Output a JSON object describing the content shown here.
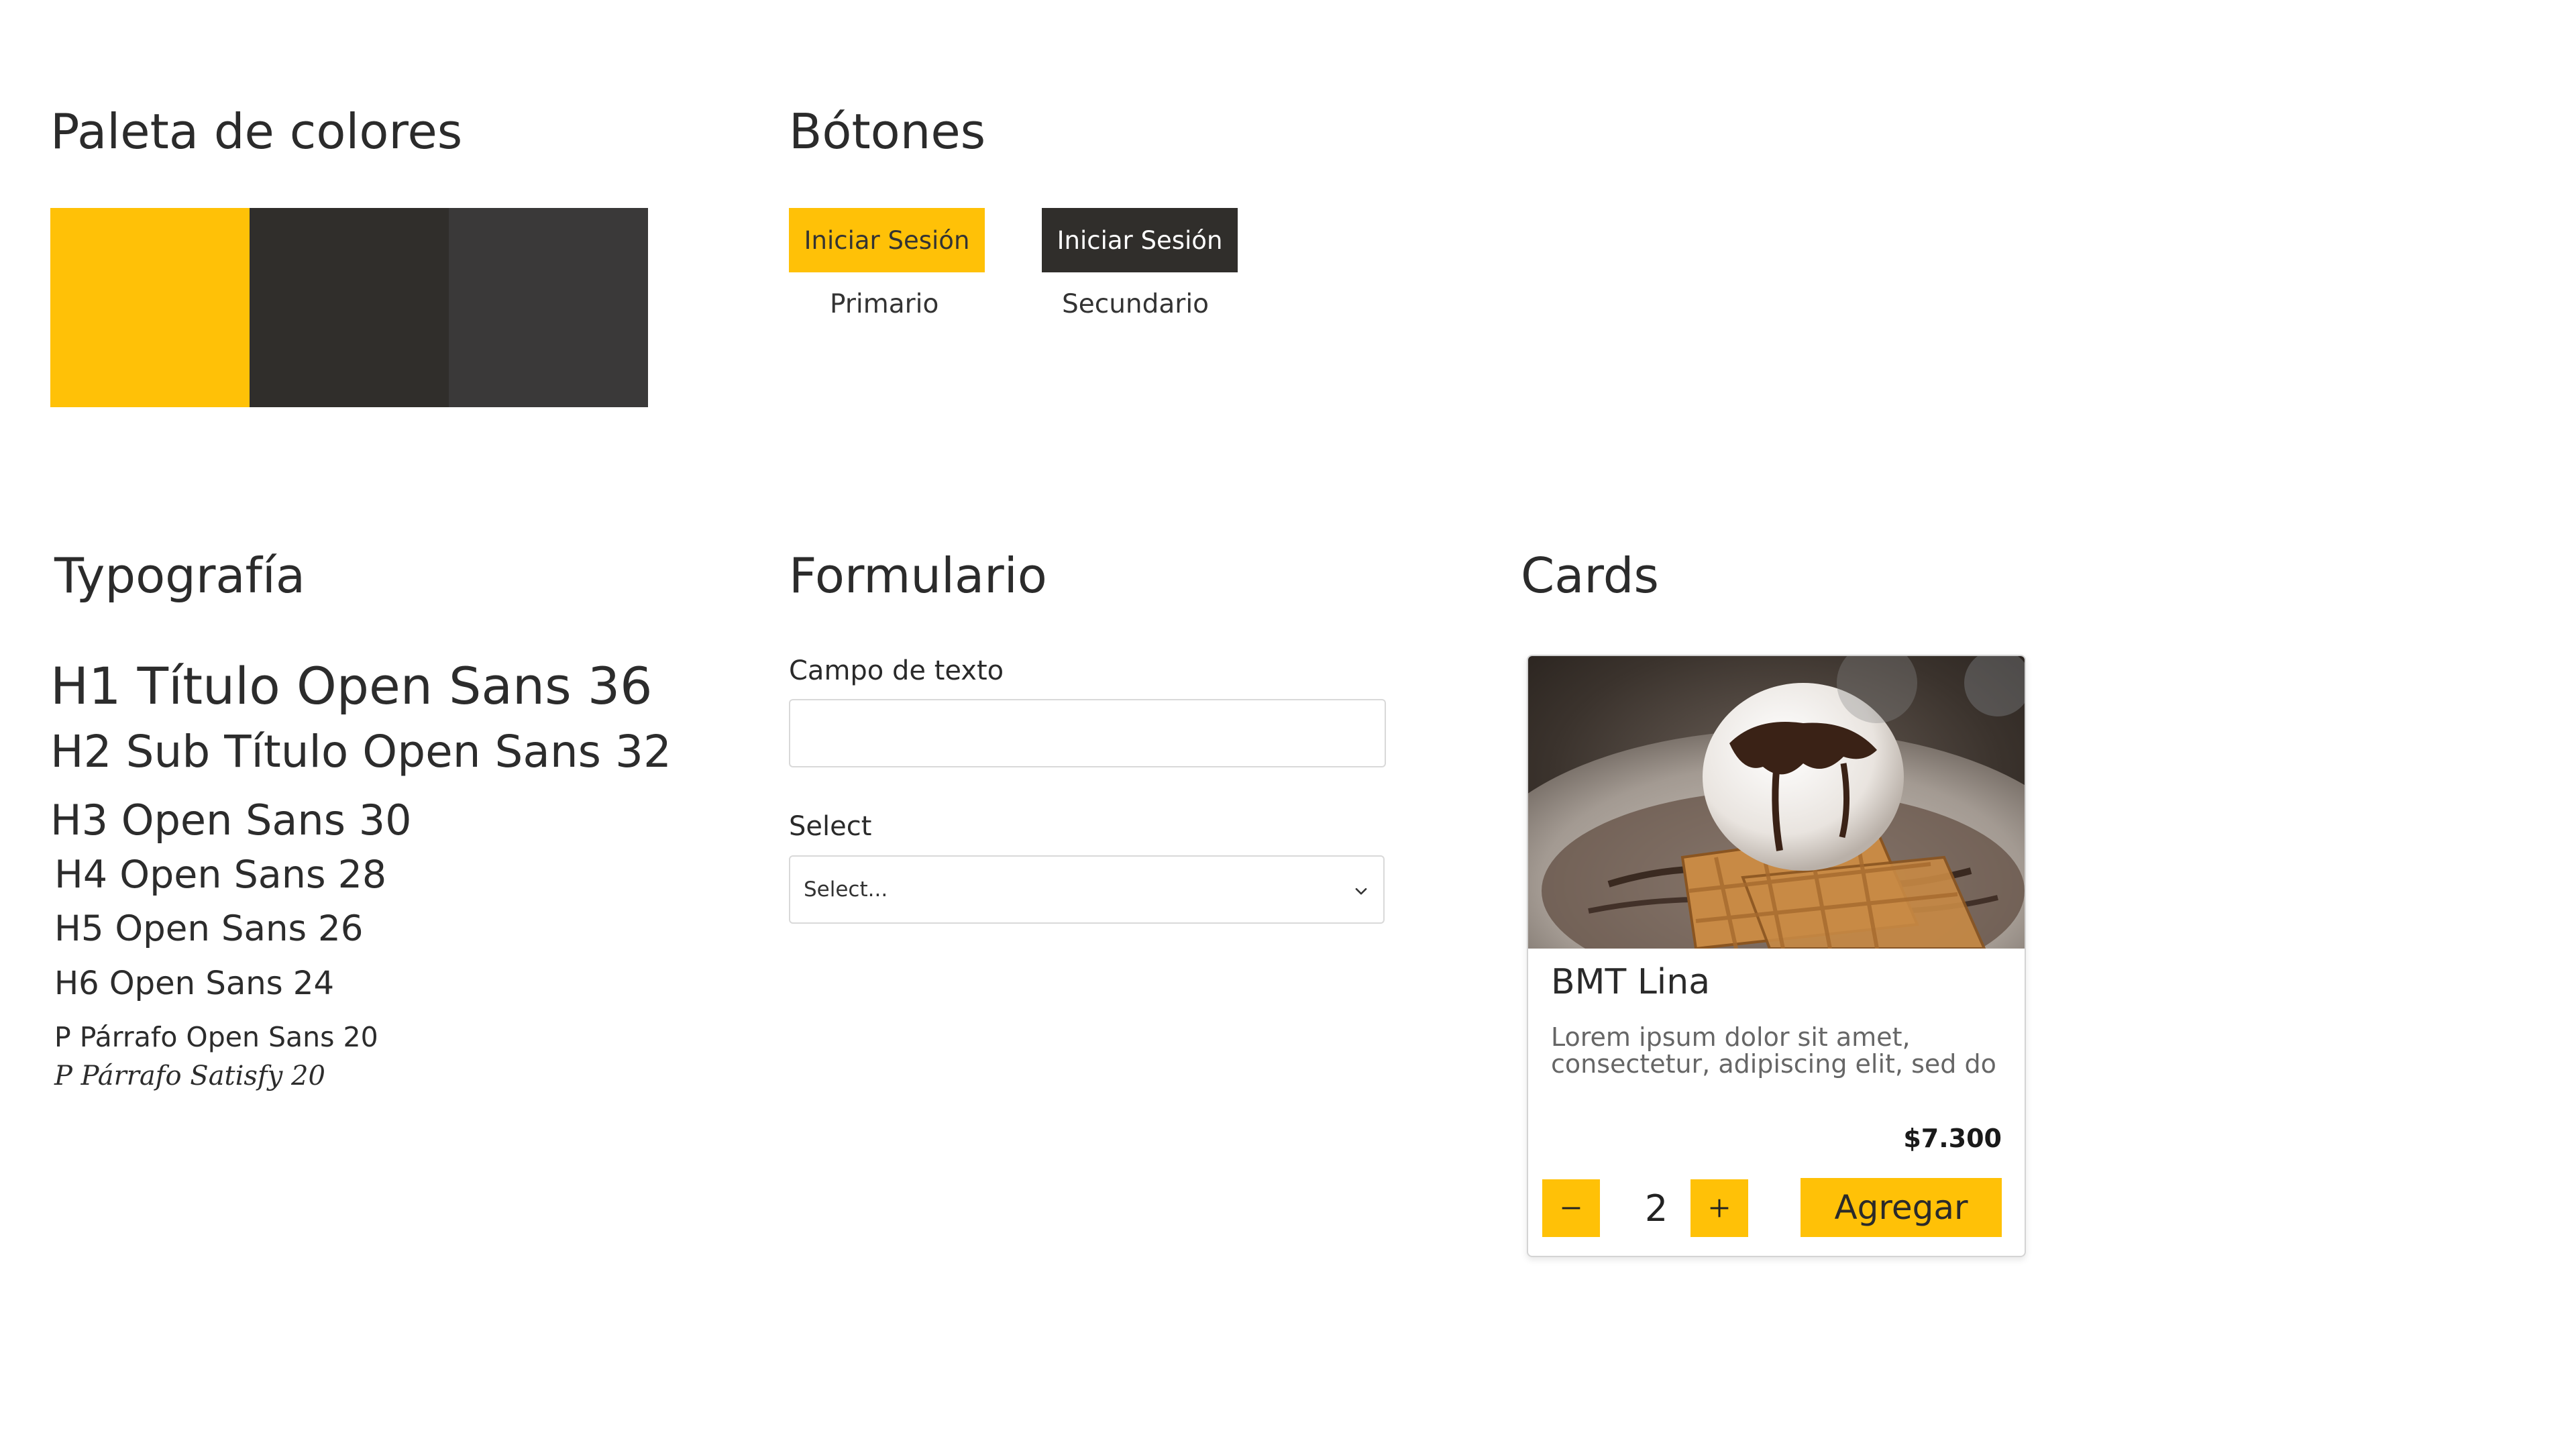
{
  "palette": {
    "title": "Paleta de colores",
    "colors": [
      "#FFC107",
      "#302E2B",
      "#3A3939"
    ]
  },
  "buttons": {
    "title": "Bótones",
    "primary": {
      "label": "Iniciar Sesión",
      "caption": "Primario",
      "bg": "#FFC107",
      "fg": "#333333"
    },
    "secondary": {
      "label": "Iniciar Sesión",
      "caption": "Secundario",
      "bg": "#302E2B",
      "fg": "#FFFFFF"
    }
  },
  "typography": {
    "title": "Typografía",
    "samples": [
      "H1 Título Open Sans 36",
      "H2 Sub Título Open Sans 32",
      "H3 Open Sans 30",
      "H4 Open Sans 28",
      "H5 Open Sans 26",
      "H6 Open Sans 24",
      "P Párrafo Open Sans 20",
      "P Párrafo Satisfy 20"
    ]
  },
  "form": {
    "title": "Formulario",
    "text_field_label": "Campo de texto",
    "text_field_value": "",
    "select_label": "Select",
    "select_value": "Select..."
  },
  "cards": {
    "title": "Cards",
    "card": {
      "name": "BMT Lina",
      "description": "Lorem ipsum dolor sit amet, consectetur, adipiscing elit, sed do",
      "price": "$7.300",
      "quantity": "2",
      "add_label": "Agregar"
    }
  }
}
